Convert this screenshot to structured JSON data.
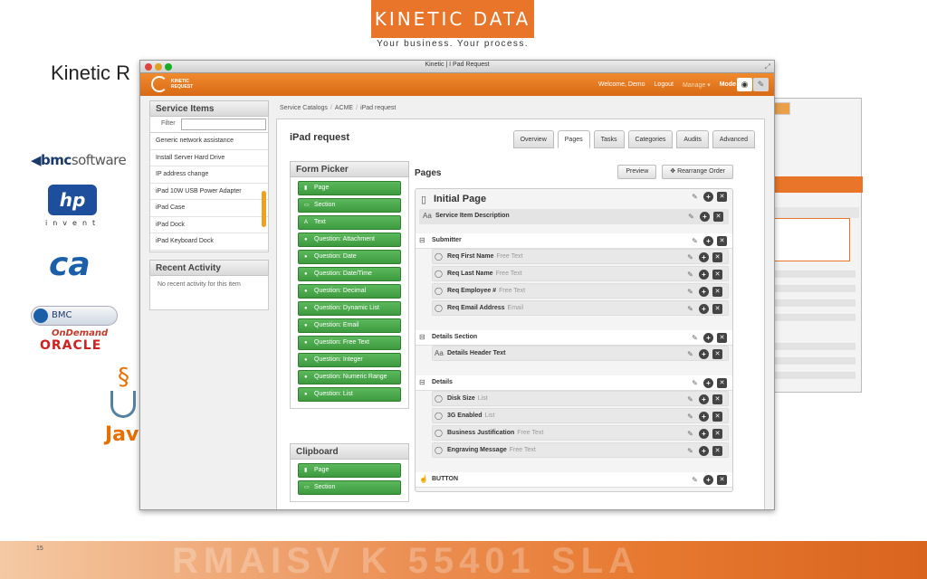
{
  "slide": {
    "logo_text": "KINETIC DATA",
    "tagline": "Your business. Your process.",
    "title": "Kinetic R",
    "page_number": "15",
    "footer_watermark": "RMAISV K 55401 SLA"
  },
  "partner_logos": {
    "bmc": "bmc",
    "bmc_suffix": "software",
    "hp": "hp",
    "hp_invent": "invent",
    "ca": "ca",
    "bmc_ondemand_prefix": "BMC",
    "bmc_ondemand_suffix": "OnDemand",
    "oracle": "ORACLE",
    "java": "Jav"
  },
  "window": {
    "title": "Kinetic | I Pad Request"
  },
  "appbar": {
    "logo_line1": "KINETIC",
    "logo_line2": "REQUEST",
    "welcome": "Welcome, Demo",
    "logout": "Logout",
    "manage": "Manage",
    "mode": "Mode"
  },
  "sidebar": {
    "service_items_title": "Service Items",
    "filter_label": "Filter",
    "filter_value": "",
    "items": [
      {
        "label": "Generic network assistance"
      },
      {
        "label": "Install Server Hard Drive"
      },
      {
        "label": "IP address change"
      },
      {
        "label": "iPad 10W USB Power Adapter"
      },
      {
        "label": "iPad Case"
      },
      {
        "label": "iPad Dock"
      },
      {
        "label": "iPad Keyboard Dock"
      }
    ],
    "recent_title": "Recent Activity",
    "recent_empty": "No recent activity for this item"
  },
  "breadcrumb": [
    "Service Catalogs",
    "ACME",
    "iPad request"
  ],
  "request": {
    "title": "iPad request",
    "tabs": [
      "Overview",
      "Pages",
      "Tasks",
      "Categories",
      "Audits",
      "Advanced"
    ],
    "active_tab": "Pages"
  },
  "form_picker": {
    "title": "Form Picker",
    "items": [
      {
        "label": "Page",
        "icon": "page-icon"
      },
      {
        "label": "Section",
        "icon": "section-icon"
      },
      {
        "label": "Text",
        "icon": "text-icon"
      },
      {
        "label": "Question: Attachment",
        "icon": "question-icon"
      },
      {
        "label": "Question: Date",
        "icon": "question-icon"
      },
      {
        "label": "Question: Date/Time",
        "icon": "question-icon"
      },
      {
        "label": "Question: Decimal",
        "icon": "question-icon"
      },
      {
        "label": "Question: Dynamic List",
        "icon": "question-icon"
      },
      {
        "label": "Question: Email",
        "icon": "question-icon"
      },
      {
        "label": "Question: Free Text",
        "icon": "question-icon"
      },
      {
        "label": "Question: Integer",
        "icon": "question-icon"
      },
      {
        "label": "Question: Numeric Range",
        "icon": "question-icon"
      },
      {
        "label": "Question: List",
        "icon": "question-icon"
      }
    ]
  },
  "clipboard": {
    "title": "Clipboard",
    "items": [
      {
        "label": "Page"
      },
      {
        "label": "Section"
      }
    ]
  },
  "pages": {
    "title": "Pages",
    "preview": "Preview",
    "rearrange": "Rearrange Order",
    "initial_page": "Initial Page",
    "service_item_description": "Service Item Description",
    "submitter": "Submitter",
    "submitter_fields": [
      {
        "label": "Req First Name",
        "type": "Free Text"
      },
      {
        "label": "Req Last Name",
        "type": "Free Text"
      },
      {
        "label": "Req Employee #",
        "type": "Free Text"
      },
      {
        "label": "Req Email Address",
        "type": "Email"
      }
    ],
    "details_section": "Details Section",
    "details_header_text": "Details Header Text",
    "details": "Details",
    "details_fields": [
      {
        "label": "Disk Size",
        "type": "List"
      },
      {
        "label": "3G Enabled",
        "type": "List"
      },
      {
        "label": "Business Justification",
        "type": "Free Text"
      },
      {
        "label": "Engraving Message",
        "type": "Free Text"
      }
    ],
    "button": "BUTTON"
  }
}
